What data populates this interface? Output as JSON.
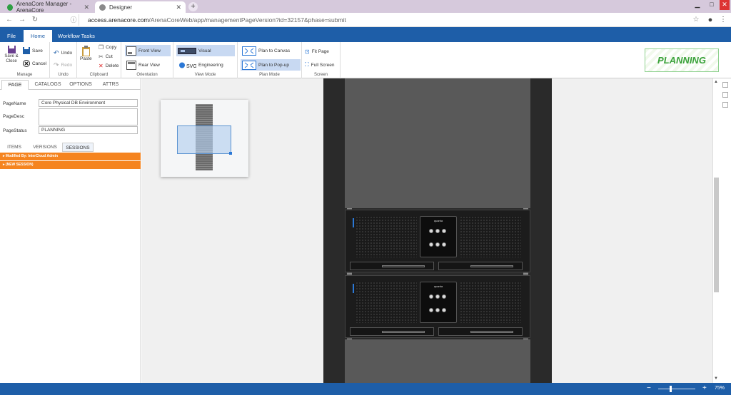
{
  "browser": {
    "tabs": [
      {
        "label": "ArenaCore Manager - ArenaCore"
      },
      {
        "label": "Designer"
      }
    ],
    "url_host": "access.arenacore.com",
    "url_path": "/ArenaCoreWeb/app/managementPageVersion?id=32157&phase=submit",
    "close_glyph": "✕",
    "new_tab_glyph": "+"
  },
  "menu": {
    "file": "File",
    "home": "Home",
    "workflow": "Workflow Tasks"
  },
  "ribbon": {
    "manage": {
      "save_close": "Save & Close",
      "save": "Save",
      "cancel": "Cancel",
      "label": "Manage"
    },
    "undo": {
      "undo": "Undo",
      "redo": "Redo",
      "label": "Undo"
    },
    "clipboard": {
      "paste": "Paste",
      "copy": "Copy",
      "cut": "Cut",
      "delete": "Delete",
      "label": "Clipboard"
    },
    "orientation": {
      "front": "Front View",
      "rear": "Rear View",
      "label": "Orientation"
    },
    "viewmode": {
      "visual": "Visual",
      "engineering": "Engineering",
      "label": "View Mode"
    },
    "planmode": {
      "canvas": "Plan to Canvas",
      "popup": "Plan to Pop-up",
      "label": "Plan Mode"
    },
    "screen": {
      "fit": "Fit Page",
      "full": "Full Screen",
      "label": "Screen"
    }
  },
  "logo": {
    "text": "PLANNING"
  },
  "panel": {
    "tabs": [
      "PAGE",
      "CATALOGS",
      "OPTIONS",
      "ATTRS"
    ],
    "fields": {
      "name_label": "PageName",
      "name_value": "Core Physical DB Environment",
      "desc_label": "PageDesc",
      "desc_value": "",
      "status_label": "PageStatus",
      "status_value": "PLANNING"
    },
    "subtabs": [
      "ITEMS",
      "VERSIONS",
      "SESSIONS"
    ],
    "sessions": [
      "Modified By: InterCloud Admin",
      "(NEW SESSION)"
    ]
  },
  "rack": {
    "brand": "quanta"
  },
  "status": {
    "zoom": "75%",
    "minus": "−",
    "plus": "+"
  },
  "colors": {
    "brand_blue": "#1e5ea8",
    "session_orange": "#f5841f",
    "planning_green": "#38a138"
  }
}
